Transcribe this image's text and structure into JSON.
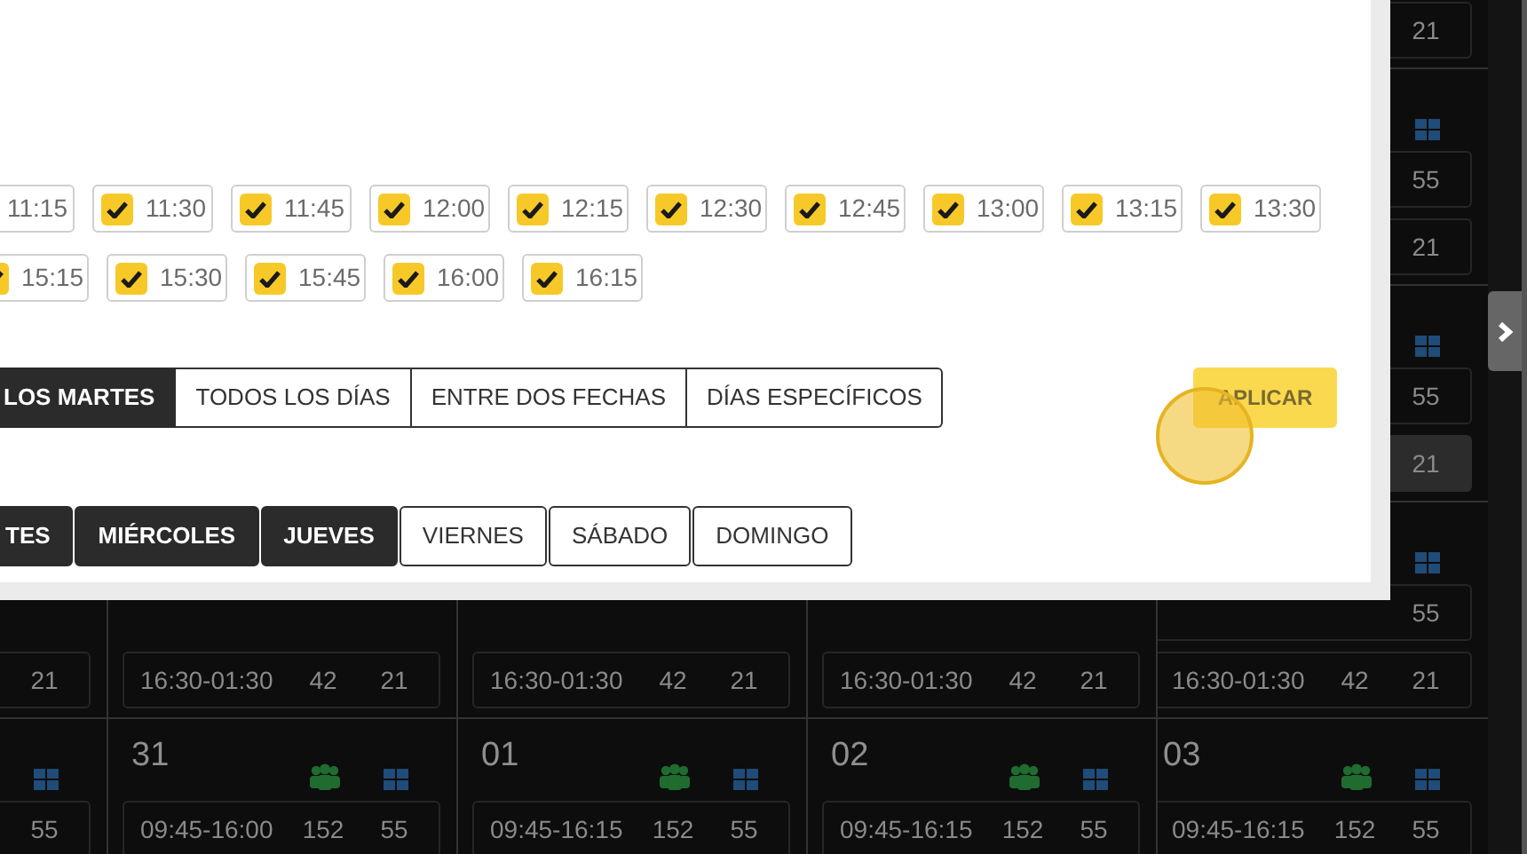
{
  "calendar": {
    "weeks": [
      {
        "column_5": {
          "lower_slot": {
            "value_2": "21",
            "highlighted": false
          }
        }
      },
      {
        "column_5": {
          "upper_slot": {
            "value_2": "55",
            "highlighted": false
          },
          "lower_slot": {
            "value_2": "21",
            "highlighted": false
          }
        }
      },
      {
        "column_5": {
          "upper_slot": {
            "value_2": "55",
            "highlighted": false
          },
          "lower_slot": {
            "value_2": "21",
            "highlighted": true
          }
        }
      },
      {
        "column_1": {
          "lower_slot": {
            "value_2": "21",
            "highlighted": false
          }
        },
        "column_2": {
          "lower_slot": {
            "time": "16:30-01:30",
            "value_1": "42",
            "value_2": "21",
            "highlighted": false
          }
        },
        "column_3": {
          "lower_slot": {
            "time": "16:30-01:30",
            "value_1": "42",
            "value_2": "21",
            "highlighted": false
          }
        },
        "column_4": {
          "lower_slot": {
            "time": "16:30-01:30",
            "value_1": "42",
            "value_2": "21",
            "highlighted": false
          }
        },
        "column_5": {
          "upper_slot": {
            "value_2": "55",
            "highlighted": false
          },
          "lower_slot": {
            "time": "16:30-01:30",
            "value_1": "42",
            "value_2": "21",
            "highlighted": false
          }
        }
      },
      {
        "column_1": {
          "upper_slot": {
            "value_2": "55",
            "highlighted": false
          }
        },
        "column_2": {
          "date": "31",
          "upper_slot": {
            "time": "09:45-16:00",
            "value_1": "152",
            "value_2": "55",
            "highlighted": false
          }
        },
        "column_3": {
          "date": "01",
          "upper_slot": {
            "time": "09:45-16:15",
            "value_1": "152",
            "value_2": "55",
            "highlighted": false
          }
        },
        "column_4": {
          "date": "02",
          "upper_slot": {
            "time": "09:45-16:15",
            "value_1": "152",
            "value_2": "55",
            "highlighted": false
          }
        },
        "column_5": {
          "date": "03",
          "upper_slot": {
            "time": "09:45-16:15",
            "value_1": "152",
            "value_2": "55",
            "highlighted": false
          }
        }
      }
    ]
  },
  "modal": {
    "time_slot_rows": [
      {
        "slots": [
          {
            "time": "11:15"
          },
          {
            "time": "11:30",
            "checked": true
          },
          {
            "time": "11:45",
            "checked": true
          },
          {
            "time": "12:00",
            "checked": true
          },
          {
            "time": "12:15",
            "checked": true
          },
          {
            "time": "12:30",
            "checked": true
          },
          {
            "time": "12:45",
            "checked": true
          },
          {
            "time": "13:00",
            "checked": true
          },
          {
            "time": "13:15",
            "checked": true
          },
          {
            "time": "13:30",
            "checked": true
          }
        ]
      },
      {
        "slots": [
          {
            "time": "15:15",
            "checked": true
          },
          {
            "time": "15:30",
            "checked": true
          },
          {
            "time": "15:45",
            "checked": true
          },
          {
            "time": "16:00",
            "checked": true
          },
          {
            "time": "16:15",
            "checked": true
          }
        ]
      }
    ],
    "repeat_options": [
      {
        "label": "LOS MARTES",
        "selected": true
      },
      {
        "label": "TODOS LOS DÍAS",
        "selected": false
      },
      {
        "label": "ENTRE DOS FECHAS",
        "selected": false
      },
      {
        "label": "DÍAS ESPECÍFICOS",
        "selected": false
      }
    ],
    "apply_button": "APLICAR",
    "weekdays": [
      {
        "label": "TES",
        "selected": true
      },
      {
        "label": "MIÉRCOLES",
        "selected": true
      },
      {
        "label": "JUEVES",
        "selected": true
      },
      {
        "label": "VIERNES",
        "selected": false
      },
      {
        "label": "SÁBADO",
        "selected": false
      },
      {
        "label": "DOMINGO",
        "selected": false
      }
    ]
  }
}
